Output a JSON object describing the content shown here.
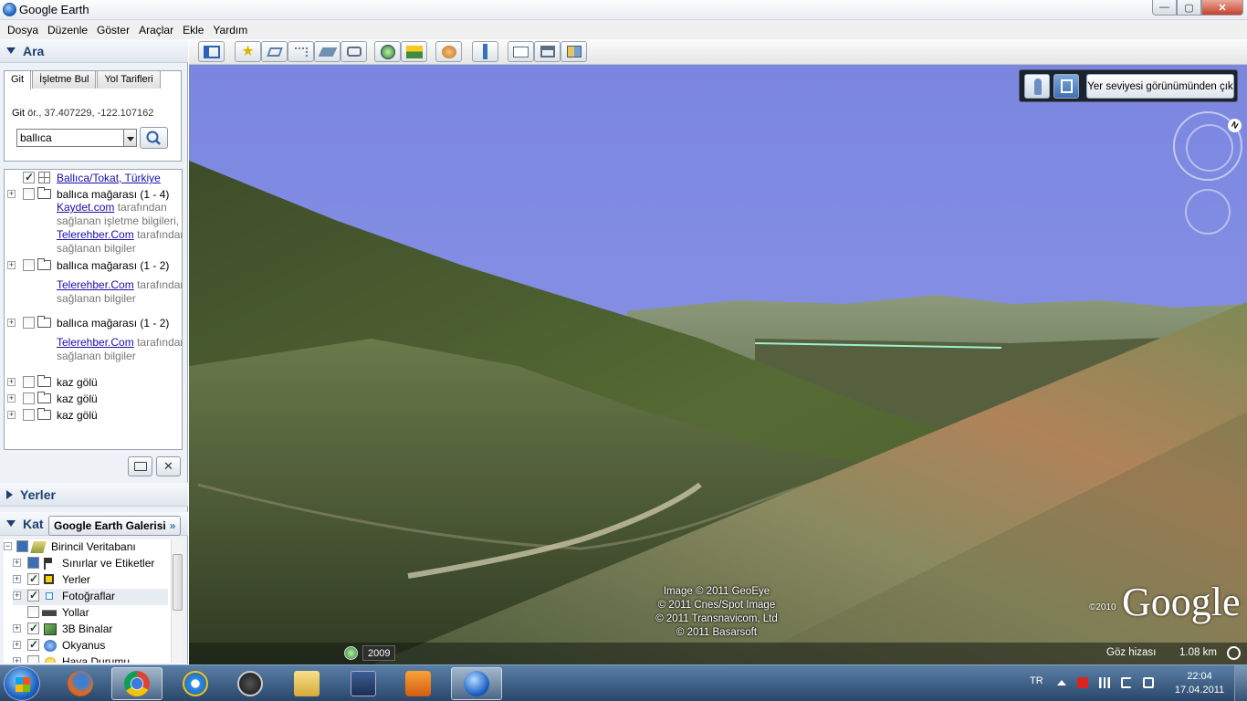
{
  "window": {
    "title": "Google Earth",
    "controls": {
      "minimize": "—",
      "maximize": "▢",
      "close": "✕"
    }
  },
  "menu": [
    "Dosya",
    "Düzenle",
    "Göster",
    "Araçlar",
    "Ekle",
    "Yardım"
  ],
  "search": {
    "section_title": "Ara",
    "tabs": [
      "Git",
      "İşletme Bul",
      "Yol Tarifleri"
    ],
    "hint_label": "Git",
    "hint_text": "ör., 37.407229, -122.107162",
    "query": "ballıca"
  },
  "results": {
    "top": {
      "label": "Ballıca/Tokat, Türkiye"
    },
    "groups": [
      {
        "label": "ballıca mağarası (1 - 4)",
        "provider1": "Kaydet.com",
        "provider1_suffix": "tarafından",
        "line2": "sağlanan işletme bilgileri,",
        "provider2": "Telerehber.Com",
        "provider2_suffix": "tarafından",
        "line4": "sağlanan bilgiler"
      },
      {
        "label": "ballıca mağarası (1 - 2)",
        "provider": "Telerehber.Com",
        "provider_suffix": "tarafından",
        "line2": "sağlanan bilgiler"
      },
      {
        "label": "ballıca mağarası (1 - 2)",
        "provider": "Telerehber.Com",
        "provider_suffix": "tarafından",
        "line2": "sağlanan bilgiler"
      }
    ],
    "lakes": [
      "kaz gölü",
      "kaz gölü",
      "kaz gölü"
    ]
  },
  "places": {
    "section_title": "Yerler"
  },
  "layers": {
    "section_title": "Kat",
    "gallery_button": "Google Earth Galerisi",
    "gallery_arrows": "»",
    "items": [
      {
        "label": "Birincil Veritabanı"
      },
      {
        "label": "Sınırlar ve Etiketler"
      },
      {
        "label": "Yerler"
      },
      {
        "label": "Fotoğraflar"
      },
      {
        "label": "Yollar"
      },
      {
        "label": "3B Binalar"
      },
      {
        "label": "Okyanus"
      },
      {
        "label": "Hava Durumu"
      }
    ]
  },
  "map": {
    "ground_exit_button": "Yer seviyesi görünümünden çık",
    "compass_label": "N",
    "credits": [
      "Image © 2011 GeoEye",
      "© 2011 Cnes/Spot Image",
      "© 2011 Transnavicom, Ltd",
      "© 2011 Basarsoft"
    ],
    "logo_year": "©2010",
    "logo": "Google",
    "year": "2009",
    "eye_altitude_label": "Göz hizası",
    "scale": "1.08 km"
  },
  "taskbar": {
    "language": "TR",
    "time": "22:04",
    "date": "17.04.2011"
  },
  "colors": {
    "sky": "#7f8be0",
    "accent": "#1e3f6e",
    "link": "#1a0dab"
  }
}
